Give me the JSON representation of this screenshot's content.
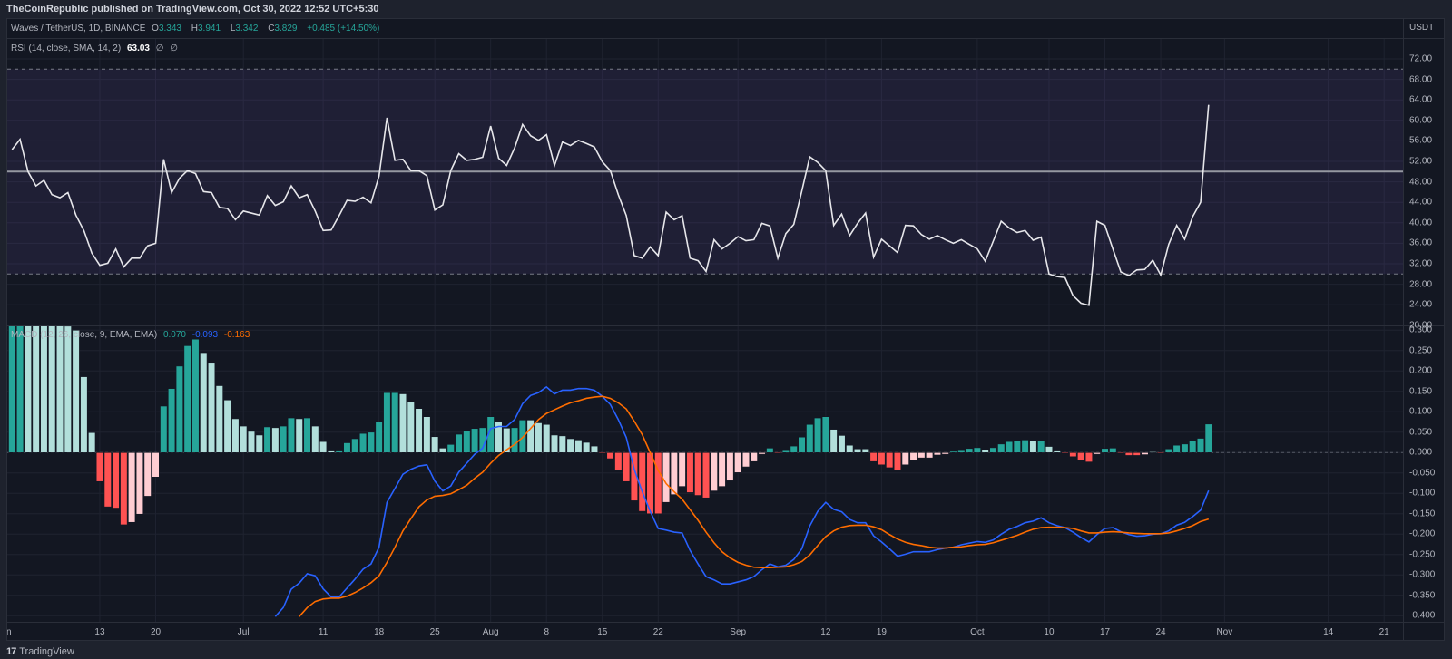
{
  "header": {
    "published": "TheCoinRepublic published on TradingView.com, Oct 30, 2022 12:52 UTC+5:30"
  },
  "price_legend": {
    "symbol": "Waves / TetherUS, 1D, BINANCE",
    "o_label": "O",
    "o": "3.343",
    "h_label": "H",
    "h": "3.941",
    "l_label": "L",
    "l": "3.342",
    "c_label": "C",
    "c": "3.829",
    "change": "+0.485 (+14.50%)",
    "currency": "USDT"
  },
  "rsi_legend": {
    "title": "RSI (14, close, SMA, 14, 2)",
    "value": "63.03",
    "na1": "∅",
    "na2": "∅"
  },
  "macd_legend": {
    "title": "MACD (12, 26, close, 9, EMA, EMA)",
    "hist": "0.070",
    "macd": "-0.093",
    "signal": "-0.163"
  },
  "footer": {
    "brand": "TradingView",
    "logo_mark": "17"
  },
  "colors": {
    "teal": "#26a69a",
    "light_teal": "#b2dfdb",
    "red": "#ff5252",
    "light_red": "#ffcdd2",
    "macd": "#2962ff",
    "signal": "#ff6d00",
    "rsi": "#e6e6ea"
  },
  "chart_data": [
    {
      "type": "line",
      "title": "RSI (14, close, SMA, 14, 2)",
      "x_unit": "day index since Jun 1 2022 (last = Oct 30)",
      "ylim": [
        20,
        72
      ],
      "y_ticks": [
        "72.00",
        "68.00",
        "64.00",
        "60.00",
        "56.00",
        "52.00",
        "48.00",
        "44.00",
        "40.00",
        "36.00",
        "32.00",
        "28.00",
        "24.00",
        "20.00"
      ],
      "bands": {
        "upper": 70,
        "middle": 50,
        "lower": 30
      },
      "values": [
        54.3,
        56.3,
        50.0,
        47.2,
        48.3,
        45.5,
        44.9,
        45.9,
        41.5,
        38.5,
        34.1,
        31.7,
        32.1,
        34.9,
        31.4,
        33.1,
        33.1,
        35.5,
        36,
        52.4,
        45.9,
        48.7,
        50.2,
        49.6,
        46.1,
        45.9,
        43,
        42.8,
        40.6,
        42.3,
        41.9,
        41.5,
        45.3,
        43.4,
        44.1,
        47.2,
        44.9,
        45.5,
        42.3,
        38.5,
        38.6,
        41.4,
        44.4,
        44.2,
        45,
        43.9,
        49.1,
        60.5,
        52.2,
        52.4,
        50.2,
        50.2,
        49.2,
        42.5,
        43.5,
        50.2,
        53.5,
        52.2,
        52.4,
        52.8,
        58.9,
        52.6,
        51.2,
        54.6,
        59.2,
        57,
        56.1,
        57.2,
        51.2,
        55.8,
        55.1,
        56.1,
        55.5,
        54.8,
        51.9,
        50.2,
        45.5,
        41.4,
        33.6,
        33.1,
        35.3,
        33.6,
        42.1,
        40.6,
        41.4,
        33.1,
        32.6,
        30.5,
        36.7,
        34.9,
        36,
        37.3,
        36.5,
        36.7,
        39.9,
        39.4,
        33.1,
        37.9,
        39.7,
        46.2,
        52.9,
        51.8,
        50.2,
        39.5,
        41.7,
        37.5,
        39.9,
        41.9,
        33.3,
        36.8,
        35.5,
        34.2,
        39.5,
        39.4,
        37.7,
        36.8,
        37.5,
        36.7,
        36,
        36.7,
        35.8,
        34.9,
        32.5,
        36.4,
        40.3,
        39,
        38.1,
        38.5,
        36.6,
        37.2,
        30,
        29.5,
        29.3,
        25.8,
        24.3,
        23.9,
        40.3,
        39.5,
        34.9,
        30.4,
        29.7,
        30.8,
        30.9,
        32.7,
        29.8,
        35.8,
        39.5,
        36.8,
        41.2,
        44,
        63.03
      ]
    },
    {
      "type": "bar+line",
      "title": "MACD (12, 26, close, 9, EMA, EMA)",
      "ylim": [
        -0.4,
        0.3
      ],
      "y_ticks": [
        "0.300",
        "0.250",
        "0.200",
        "0.150",
        "0.100",
        "0.050",
        "0.000",
        "-0.050",
        "-0.100",
        "-0.150",
        "-0.200",
        "-0.250",
        "-0.300",
        "-0.350",
        "-0.400"
      ],
      "histogram": [
        0.33,
        0.36,
        0.36,
        0.35,
        0.34,
        0.33,
        0.32,
        0.31,
        0.3,
        0.186,
        0.049,
        -0.071,
        -0.133,
        -0.136,
        -0.177,
        -0.171,
        -0.151,
        -0.107,
        -0.06,
        0.114,
        0.157,
        0.212,
        0.262,
        0.278,
        0.245,
        0.219,
        0.164,
        0.129,
        0.083,
        0.065,
        0.052,
        0.043,
        0.063,
        0.061,
        0.065,
        0.085,
        0.083,
        0.085,
        0.065,
        0.027,
        0.006,
        0.006,
        0.024,
        0.034,
        0.047,
        0.05,
        0.075,
        0.147,
        0.147,
        0.144,
        0.124,
        0.108,
        0.088,
        0.039,
        0.011,
        0.02,
        0.045,
        0.054,
        0.059,
        0.061,
        0.088,
        0.075,
        0.06,
        0.061,
        0.08,
        0.08,
        0.073,
        0.069,
        0.043,
        0.041,
        0.034,
        0.031,
        0.025,
        0.016,
        -0.001,
        -0.015,
        -0.043,
        -0.071,
        -0.118,
        -0.144,
        -0.15,
        -0.15,
        -0.122,
        -0.103,
        -0.083,
        -0.098,
        -0.105,
        -0.111,
        -0.094,
        -0.083,
        -0.069,
        -0.049,
        -0.035,
        -0.022,
        -0.004,
        0.011,
        -0.001,
        0.007,
        0.016,
        0.038,
        0.069,
        0.085,
        0.088,
        0.057,
        0.042,
        0.018,
        0.009,
        0.009,
        -0.022,
        -0.03,
        -0.037,
        -0.043,
        -0.03,
        -0.018,
        -0.013,
        -0.013,
        -0.006,
        -0.004,
        0.003,
        0.007,
        0.01,
        0.012,
        0.008,
        0.012,
        0.021,
        0.027,
        0.028,
        0.031,
        0.029,
        0.028,
        0.015,
        0.006,
        -0.001,
        -0.01,
        -0.018,
        -0.023,
        -0.004,
        0.01,
        0.011,
        -0.001,
        -0.007,
        -0.007,
        -0.005,
        0.002,
        -0.001,
        0.009,
        0.018,
        0.021,
        0.028,
        0.035,
        0.07
      ],
      "histogram_colors": [
        "g",
        "g",
        "lg",
        "lg",
        "lg",
        "lg",
        "lg",
        "lg",
        "lg",
        "lg",
        "lg",
        "r",
        "r",
        "r",
        "r",
        "lr",
        "lr",
        "lr",
        "lr",
        "g",
        "g",
        "g",
        "g",
        "g",
        "lg",
        "lg",
        "lg",
        "lg",
        "lg",
        "lg",
        "lg",
        "lg",
        "g",
        "lg",
        "g",
        "g",
        "lg",
        "g",
        "lg",
        "lg",
        "lg",
        "g",
        "g",
        "g",
        "g",
        "g",
        "g",
        "g",
        "g",
        "lg",
        "lg",
        "lg",
        "lg",
        "lg",
        "lg",
        "g",
        "g",
        "g",
        "g",
        "g",
        "g",
        "lg",
        "lg",
        "g",
        "g",
        "lg",
        "lg",
        "lg",
        "lg",
        "lg",
        "lg",
        "lg",
        "lg",
        "lg",
        "r",
        "r",
        "r",
        "r",
        "r",
        "r",
        "r",
        "r",
        "lr",
        "lr",
        "lr",
        "r",
        "r",
        "r",
        "lr",
        "lr",
        "lr",
        "lr",
        "lr",
        "lr",
        "lr",
        "g",
        "r",
        "g",
        "g",
        "g",
        "g",
        "g",
        "g",
        "lg",
        "lg",
        "lg",
        "lg",
        "lg",
        "r",
        "r",
        "r",
        "r",
        "lr",
        "lr",
        "lr",
        "lr",
        "lr",
        "lr",
        "g",
        "g",
        "g",
        "g",
        "lg",
        "g",
        "g",
        "g",
        "g",
        "g",
        "lg",
        "g",
        "lg",
        "lg",
        "r",
        "r",
        "r",
        "r",
        "lr",
        "g",
        "g",
        "r",
        "r",
        "r",
        "lr",
        "lg",
        "r",
        "g",
        "g",
        "g",
        "g",
        "g",
        "g"
      ],
      "series": [
        {
          "name": "MACD",
          "values": [
            -0.402,
            -0.38,
            -0.335,
            -0.32,
            -0.297,
            -0.302,
            -0.334,
            -0.354,
            -0.354,
            -0.332,
            -0.31,
            -0.286,
            -0.273,
            -0.232,
            -0.122,
            -0.088,
            -0.053,
            -0.041,
            -0.033,
            -0.03,
            -0.07,
            -0.094,
            -0.082,
            -0.048,
            -0.026,
            -0.004,
            0.011,
            0.059,
            0.064,
            0.064,
            0.081,
            0.12,
            0.14,
            0.147,
            0.161,
            0.144,
            0.153,
            0.153,
            0.157,
            0.157,
            0.153,
            0.138,
            0.118,
            0.081,
            0.037,
            -0.041,
            -0.096,
            -0.144,
            -0.186,
            -0.19,
            -0.195,
            -0.197,
            -0.24,
            -0.273,
            -0.304,
            -0.312,
            -0.322,
            -0.322,
            -0.317,
            -0.312,
            -0.304,
            -0.287,
            -0.273,
            -0.28,
            -0.276,
            -0.262,
            -0.236,
            -0.18,
            -0.144,
            -0.122,
            -0.139,
            -0.145,
            -0.164,
            -0.172,
            -0.172,
            -0.204,
            -0.219,
            -0.236,
            -0.254,
            -0.249,
            -0.243,
            -0.243,
            -0.243,
            -0.238,
            -0.234,
            -0.232,
            -0.226,
            -0.222,
            -0.218,
            -0.22,
            -0.214,
            -0.2,
            -0.188,
            -0.181,
            -0.172,
            -0.168,
            -0.16,
            -0.172,
            -0.179,
            -0.184,
            -0.195,
            -0.208,
            -0.219,
            -0.201,
            -0.186,
            -0.184,
            -0.194,
            -0.201,
            -0.205,
            -0.204,
            -0.2,
            -0.199,
            -0.192,
            -0.178,
            -0.171,
            -0.157,
            -0.141,
            -0.093
          ]
        },
        {
          "name": "Signal",
          "values": [
            -0.402,
            -0.38,
            -0.365,
            -0.359,
            -0.357,
            -0.357,
            -0.352,
            -0.343,
            -0.332,
            -0.319,
            -0.302,
            -0.269,
            -0.232,
            -0.192,
            -0.162,
            -0.133,
            -0.116,
            -0.107,
            -0.105,
            -0.101,
            -0.091,
            -0.08,
            -0.063,
            -0.048,
            -0.026,
            -0.007,
            0.007,
            0.02,
            0.037,
            0.059,
            0.081,
            0.096,
            0.105,
            0.114,
            0.122,
            0.127,
            0.133,
            0.136,
            0.138,
            0.133,
            0.122,
            0.107,
            0.077,
            0.044,
            0,
            -0.044,
            -0.076,
            -0.096,
            -0.114,
            -0.14,
            -0.166,
            -0.195,
            -0.221,
            -0.243,
            -0.258,
            -0.269,
            -0.276,
            -0.281,
            -0.282,
            -0.282,
            -0.281,
            -0.28,
            -0.275,
            -0.267,
            -0.251,
            -0.228,
            -0.206,
            -0.192,
            -0.183,
            -0.179,
            -0.178,
            -0.178,
            -0.182,
            -0.189,
            -0.201,
            -0.212,
            -0.22,
            -0.225,
            -0.228,
            -0.232,
            -0.234,
            -0.234,
            -0.232,
            -0.231,
            -0.228,
            -0.226,
            -0.225,
            -0.221,
            -0.215,
            -0.209,
            -0.203,
            -0.195,
            -0.188,
            -0.184,
            -0.183,
            -0.183,
            -0.184,
            -0.186,
            -0.192,
            -0.197,
            -0.197,
            -0.195,
            -0.194,
            -0.195,
            -0.197,
            -0.198,
            -0.199,
            -0.199,
            -0.199,
            -0.197,
            -0.192,
            -0.186,
            -0.179,
            -0.169,
            -0.163
          ]
        }
      ]
    }
  ],
  "time_axis": [
    {
      "label": "Jun",
      "day": 0
    },
    {
      "label": "13",
      "day": 12
    },
    {
      "label": "20",
      "day": 19
    },
    {
      "label": "Jul",
      "day": 30
    },
    {
      "label": "11",
      "day": 40
    },
    {
      "label": "18",
      "day": 47
    },
    {
      "label": "25",
      "day": 54
    },
    {
      "label": "Aug",
      "day": 61
    },
    {
      "label": "8",
      "day": 68
    },
    {
      "label": "15",
      "day": 75
    },
    {
      "label": "22",
      "day": 82
    },
    {
      "label": "Sep",
      "day": 92
    },
    {
      "label": "12",
      "day": 103
    },
    {
      "label": "19",
      "day": 110
    },
    {
      "label": "Oct",
      "day": 122
    },
    {
      "label": "10",
      "day": 131
    },
    {
      "label": "17",
      "day": 138
    },
    {
      "label": "24",
      "day": 145
    },
    {
      "label": "Nov",
      "day": 153
    },
    {
      "label": "14",
      "day": 166
    },
    {
      "label": "21",
      "day": 173
    }
  ],
  "last_day": 151
}
